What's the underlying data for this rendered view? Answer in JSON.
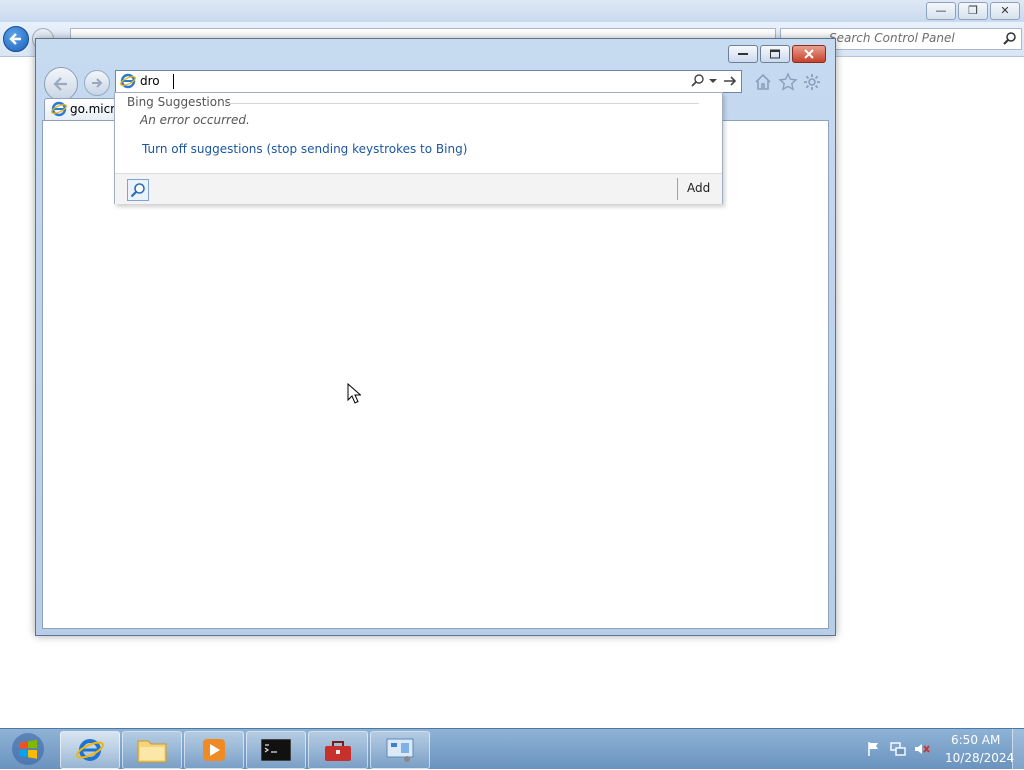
{
  "background_window": {
    "search_placeholder": "Search Control Panel"
  },
  "ie": {
    "address_value": "dro",
    "tab_label": "go.micro"
  },
  "suggestions": {
    "title": "Bing Suggestions",
    "error_text": "An error occurred.",
    "turn_off_text": "Turn off suggestions (stop sending keystrokes to Bing)",
    "add_label": "Add"
  },
  "taskbar": {
    "time": "6:50 AM",
    "date": "10/28/2024"
  },
  "colors": {
    "link": "#1b57a3",
    "taskbar": "#6a93bf"
  }
}
